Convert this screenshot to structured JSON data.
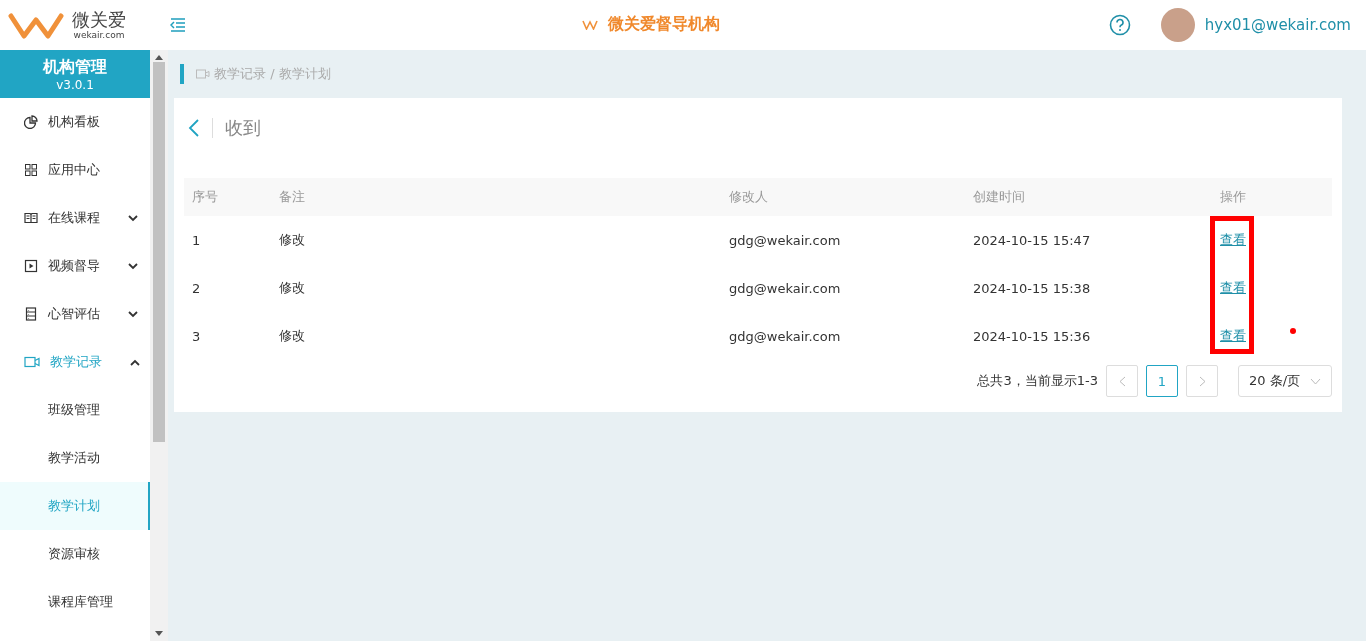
{
  "header": {
    "logo_text": "微关爱",
    "logo_domain": "wekair.com",
    "title": "微关爱督导机构",
    "user": "hyx01@wekair.com"
  },
  "sidebar": {
    "title": "机构管理",
    "version": "v3.0.1",
    "items": [
      {
        "label": "机构看板",
        "selected": false
      },
      {
        "label": "应用中心",
        "selected": false
      },
      {
        "label": "在线课程",
        "selected": false,
        "expanded": false
      },
      {
        "label": "视频督导",
        "selected": false,
        "expanded": false
      },
      {
        "label": "心智评估",
        "selected": false,
        "expanded": false
      },
      {
        "label": "教学记录",
        "selected": true,
        "expanded": true,
        "children": [
          {
            "label": "班级管理",
            "selected": false
          },
          {
            "label": "教学活动",
            "selected": false
          },
          {
            "label": "教学计划",
            "selected": true
          },
          {
            "label": "资源审核",
            "selected": false
          },
          {
            "label": "课程库管理",
            "selected": false
          }
        ]
      }
    ]
  },
  "breadcrumb": "教学记录 / 教学计划",
  "page_title": "收到",
  "table": {
    "columns": [
      "序号",
      "备注",
      "修改人",
      "创建时间",
      "操作"
    ],
    "rows": [
      {
        "cells": [
          "1",
          "修改",
          "gdg@wekair.com",
          "2024-10-15 15:47"
        ],
        "action": "查看"
      },
      {
        "cells": [
          "2",
          "修改",
          "gdg@wekair.com",
          "2024-10-15 15:38"
        ],
        "action": "查看"
      },
      {
        "cells": [
          "3",
          "修改",
          "gdg@wekair.com",
          "2024-10-15 15:36"
        ],
        "action": "查看"
      }
    ]
  },
  "pagination": {
    "summary": "总共3，当前显示1-3",
    "pages": [
      {
        "label": "1",
        "selected": true
      }
    ],
    "page_size": "20 条/页"
  }
}
